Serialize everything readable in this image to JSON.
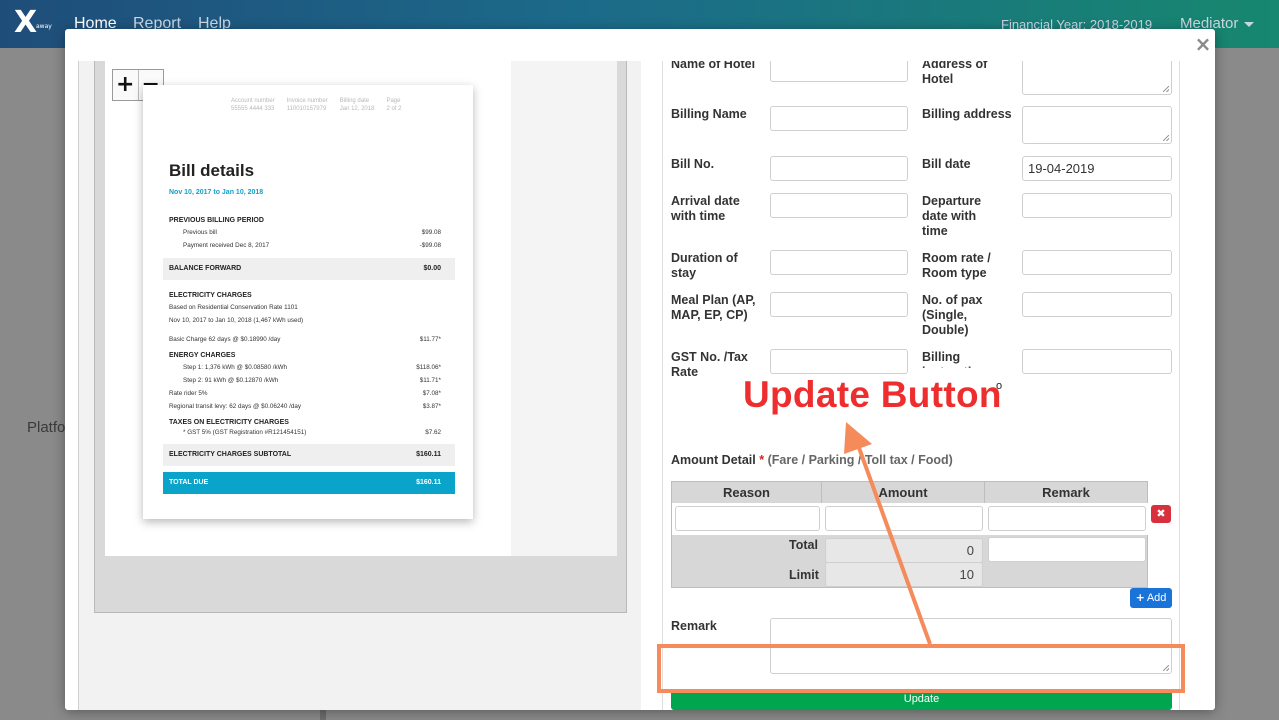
{
  "navbar": {
    "logo_text": "X",
    "logo_sub": "away",
    "items": [
      {
        "label": "Home",
        "active": true
      },
      {
        "label": "Report",
        "active": false
      },
      {
        "label": "Help",
        "active": false
      }
    ],
    "financial_year": "Financial Year: 2018-2019",
    "role_label": "Mediator"
  },
  "background": {
    "partial_text": "Platfo"
  },
  "modal": {
    "close_icon": "×",
    "viewer": {
      "zoom_in": "+",
      "zoom_out": "−",
      "bill": {
        "header": {
          "account_label": "Account number",
          "account_value": "55555 4444 333",
          "invoice_label": "Invoice number",
          "invoice_value": "110010157979",
          "billing_label": "Billing date",
          "billing_value": "Jan 12, 2018",
          "page_label": "Page",
          "page_value": "2 of 2"
        },
        "title": "Bill details",
        "period": "Nov 10, 2017 to Jan 10, 2018",
        "prev_section": "PREVIOUS BILLING PERIOD",
        "prev_bill_label": "Previous bill",
        "prev_bill_value": "$99.08",
        "payment_label": "Payment received Dec 8, 2017",
        "payment_value": "-$99.08",
        "balance_label": "BALANCE FORWARD",
        "balance_value": "$0.00",
        "elec_section": "ELECTRICITY CHARGES",
        "rate_note": "Based on Residential Conservation Rate 1101",
        "usage_note": "Nov 10, 2017 to Jan 10, 2018 (1,467 kWh used)",
        "basic_label": "Basic Charge 62 days @ $0.18990 /day",
        "basic_value": "$11.77*",
        "energy_section": "ENERGY CHARGES",
        "step1_label": "Step 1: 1,376 kWh @ $0.08580 /kWh",
        "step1_value": "$118.06*",
        "step2_label": "Step 2: 91 kWh @ $0.12870 /kWh",
        "step2_value": "$11.71*",
        "rider_label": "Rate rider 5%",
        "rider_value": "$7.08*",
        "transit_label": "Regional transit levy: 62 days @ $0.06240 /day",
        "transit_value": "$3.87*",
        "taxes_section": "TAXES ON ELECTRICITY CHARGES",
        "gst_label": "* GST 5% (GST Registration #R121454151)",
        "gst_value": "$7.62",
        "subtotal_label": "ELECTRICITY CHARGES SUBTOTAL",
        "subtotal_value": "$160.11",
        "total_label": "TOTAL DUE",
        "total_value": "$160.11"
      }
    },
    "form": {
      "name_of_hotel_label": "Name of Hotel",
      "address_of_hotel_label": "Address of Hotel",
      "billing_name_label": "Billing Name",
      "billing_address_label": "Billing address",
      "bill_no_label": "Bill No.",
      "bill_date_label": "Bill date",
      "bill_date_value": "19-04-2019",
      "arrival_label": "Arrival date with time",
      "departure_label": "Departure date with time",
      "duration_label": "Duration of stay",
      "room_rate_label": "Room rate / Room type",
      "meal_plan_label": "Meal Plan (AP, MAP, EP, CP)",
      "pax_label": "No. of pax (Single, Double)",
      "gst_label": "GST No. /Tax Rate",
      "billing_instruction_label": "Billing instruction",
      "amount_detail_label": "Amount Detail",
      "amount_required_mark": "*",
      "amount_hint": "(Fare / Parking / Toll tax / Food)",
      "table_headers": [
        "Reason",
        "Amount",
        "Remark"
      ],
      "total_label": "Total",
      "total_value": "0",
      "limit_label": "Limit",
      "limit_value": "10",
      "delete_icon": "✖",
      "add_label": "Add",
      "add_icon": "+",
      "remark_label": "Remark",
      "update_label": "Update"
    }
  },
  "annotation": {
    "text": "Update Button",
    "degree_mark": "o",
    "color": "#ee2e2e",
    "box_color": "#f58b5a"
  }
}
